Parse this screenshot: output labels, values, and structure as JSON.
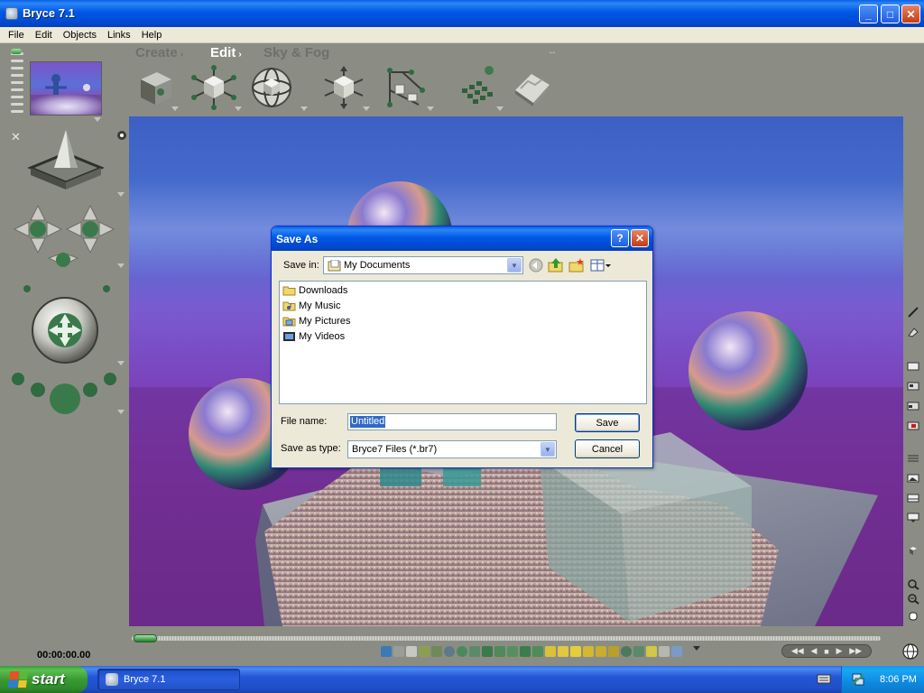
{
  "window": {
    "title": "Bryce 7.1",
    "controls": {
      "minimize": "_",
      "maximize": "□",
      "close": "✕"
    }
  },
  "menubar": {
    "items": [
      "File",
      "Edit",
      "Objects",
      "Links",
      "Help"
    ]
  },
  "toolbar": {
    "tabs": [
      {
        "label": "Create",
        "arrow": "›"
      },
      {
        "label": "Edit",
        "arrow": "›"
      },
      {
        "label": "Sky & Fog",
        "arrow": ""
      }
    ],
    "tools": [
      {
        "name": "material-lab-tool",
        "icon": "cube-icon"
      },
      {
        "name": "resize-tool",
        "icon": "resize-cube-icon"
      },
      {
        "name": "rotate-tool",
        "icon": "rotate-sphere-icon"
      },
      {
        "name": "reposition-tool",
        "icon": "reposition-cube-icon"
      },
      {
        "name": "align-tool",
        "icon": "align-icon"
      },
      {
        "name": "randomize-tool",
        "icon": "randomize-grid-icon"
      },
      {
        "name": "terrain-editor-tool",
        "icon": "terrain-icon"
      }
    ]
  },
  "left_panel": {
    "elapsed_time": "00:00:00.00"
  },
  "dialog": {
    "title": "Save As",
    "help": "?",
    "close": "✕",
    "save_in_label": "Save in:",
    "save_in_value": "My Documents",
    "files": [
      {
        "name": "Downloads",
        "icon": "folder-icon"
      },
      {
        "name": "My Music",
        "icon": "music-folder-icon"
      },
      {
        "name": "My Pictures",
        "icon": "pictures-folder-icon"
      },
      {
        "name": "My Videos",
        "icon": "videos-folder-icon"
      }
    ],
    "filename_label": "File name:",
    "filename_value": "Untitled",
    "filetype_label": "Save as type:",
    "filetype_value": "Bryce7 Files (*.br7)",
    "save_button": "Save",
    "cancel_button": "Cancel"
  },
  "taskbar": {
    "start_label": "start",
    "task_label": "Bryce 7.1",
    "clock": "8:06 PM"
  },
  "colors": {
    "xp_blue": "#0058e6",
    "start_green": "#3a9a33",
    "panel_gray": "#8b8d84",
    "dialog_bg": "#ece9d8",
    "selection": "#316ac5"
  }
}
